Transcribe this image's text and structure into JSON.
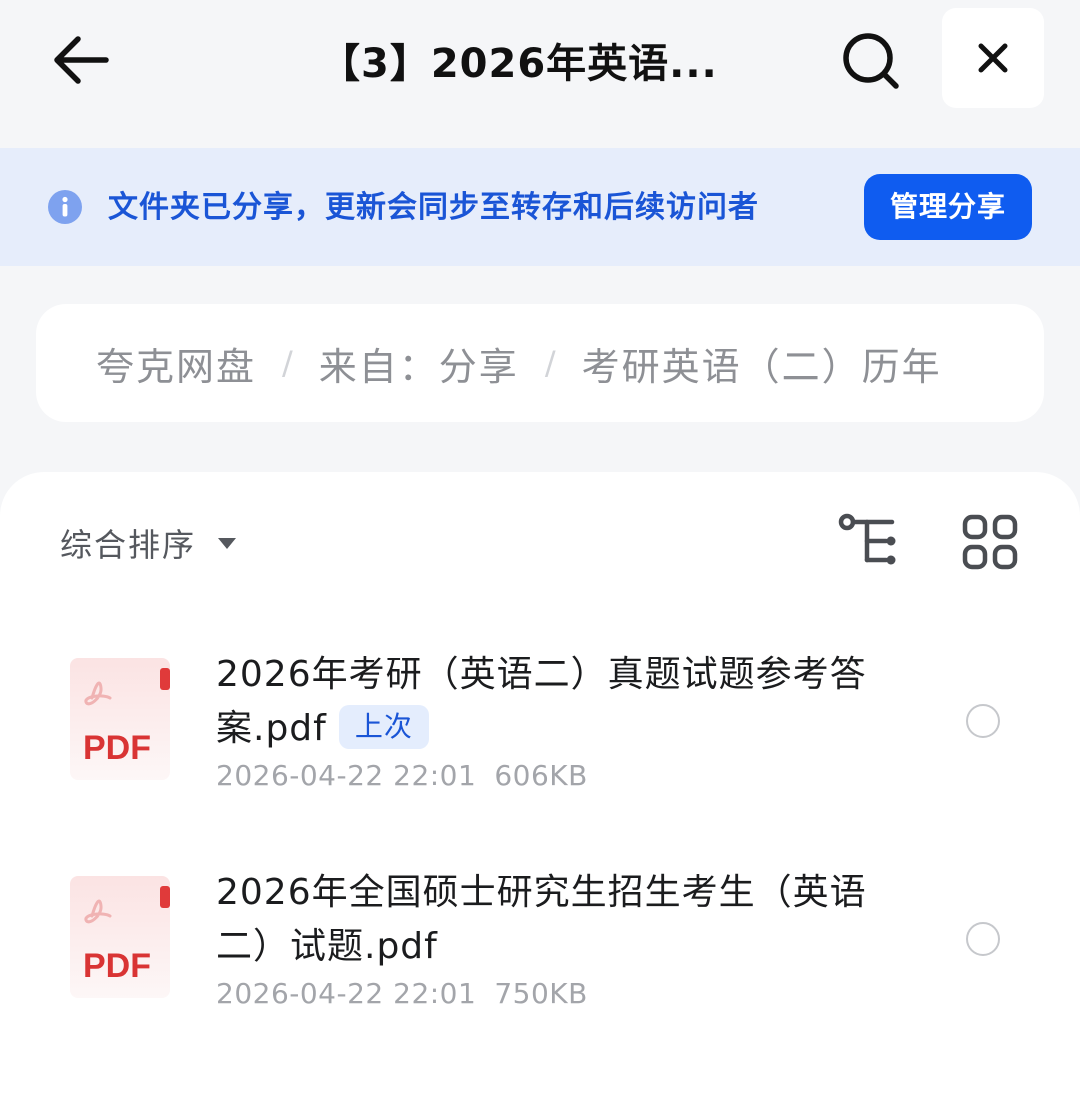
{
  "header": {
    "title": "【3】2026年英语...",
    "back_icon": "arrow-left-icon",
    "search_icon": "search-icon",
    "close_icon": "close-icon"
  },
  "banner": {
    "icon": "info-icon",
    "text": "文件夹已分享，更新会同步至转存和后续访问者",
    "button_label": "管理分享",
    "accent_color": "#0f5cf0"
  },
  "breadcrumb": {
    "items": [
      "夸克网盘",
      "来自：分享",
      "考研英语（二）历年"
    ],
    "separator": "/"
  },
  "toolbar": {
    "sort_label": "综合排序",
    "sort_icon": "caret-down-icon",
    "tree_icon": "tree-view-icon",
    "grid_icon": "grid-view-icon"
  },
  "files": [
    {
      "icon": "pdf-file-icon",
      "icon_label": "PDF",
      "name": "2026年考研（英语二）真题试题参考答案.pdf",
      "tag": "上次",
      "date": "2026-04-22 22:01",
      "size": "606KB",
      "selected": false
    },
    {
      "icon": "pdf-file-icon",
      "icon_label": "PDF",
      "name": "2026年全国硕士研究生招生考生（英语二）试题.pdf",
      "tag": "",
      "date": "2026-04-22 22:01",
      "size": "750KB",
      "selected": false
    }
  ]
}
